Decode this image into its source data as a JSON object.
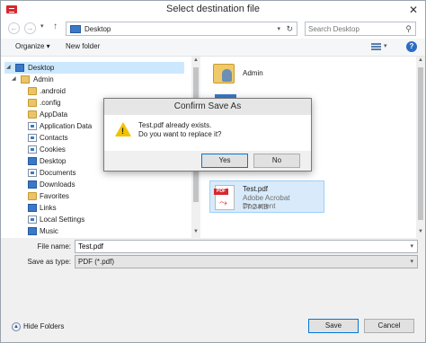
{
  "window": {
    "title": "Select destination file",
    "close_glyph": "✕"
  },
  "address_bar": {
    "back_glyph": "←",
    "forward_glyph": "→",
    "recent_glyph": "▾",
    "up_glyph": "↑",
    "location": "Desktop",
    "refresh_glyph": "↻",
    "search_placeholder": "Search Desktop",
    "search_glyph": "⚲"
  },
  "toolbar": {
    "organize": "Organize ▾",
    "new_folder": "New folder",
    "help": "?"
  },
  "nav_tree": {
    "root": "Desktop",
    "user": "Admin",
    "items": [
      ".android",
      ".config",
      "AppData",
      "Application Data",
      "Contacts",
      "Cookies",
      "Desktop",
      "Documents",
      "Downloads",
      "Favorites",
      "Links",
      "Local Settings",
      "Music"
    ]
  },
  "content": {
    "folder_label": "Admin",
    "file": {
      "name": "Test.pdf",
      "type": "Adobe Acrobat Document",
      "size": "77.2 KB",
      "badge": "PDF"
    }
  },
  "fields": {
    "file_name_label": "File name:",
    "file_name_value": "Test.pdf",
    "save_type_label": "Save as type:",
    "save_type_value": "PDF (*.pdf)"
  },
  "footer": {
    "hide_folders": "Hide Folders",
    "save": "Save",
    "cancel": "Cancel"
  },
  "confirm_dialog": {
    "title": "Confirm Save As",
    "line1": "Test.pdf already exists.",
    "line2": "Do you want to replace it?",
    "yes": "Yes",
    "no": "No"
  },
  "colors": {
    "accent": "#0078d7",
    "selection": "#cce8ff",
    "pdf_red": "#d7282e",
    "warning": "#f2c200"
  }
}
